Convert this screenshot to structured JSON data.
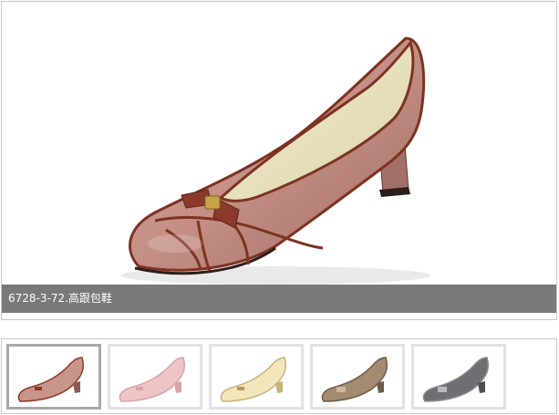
{
  "viewer": {
    "caption": "6728-3-72.高跟包鞋",
    "main_icon": "pink-pump-shoe-photo"
  },
  "thumbnails": [
    {
      "icon": "pink-pump-shoe-thumb",
      "color": "#c8958a",
      "trim": "#8a3a2a",
      "selected": true
    },
    {
      "icon": "light-pink-pump-shoe-thumb",
      "color": "#efc4c6",
      "trim": "#d9a2a6",
      "selected": false
    },
    {
      "icon": "cream-pump-shoe-thumb",
      "color": "#f2e6bc",
      "trim": "#c9b27a",
      "selected": false
    },
    {
      "icon": "taupe-pump-shoe-thumb",
      "color": "#a58a72",
      "trim": "#6f5a48",
      "selected": false
    },
    {
      "icon": "gray-pump-shoe-thumb",
      "color": "#6e6e74",
      "trim": "#8a8a90",
      "selected": false
    }
  ]
}
